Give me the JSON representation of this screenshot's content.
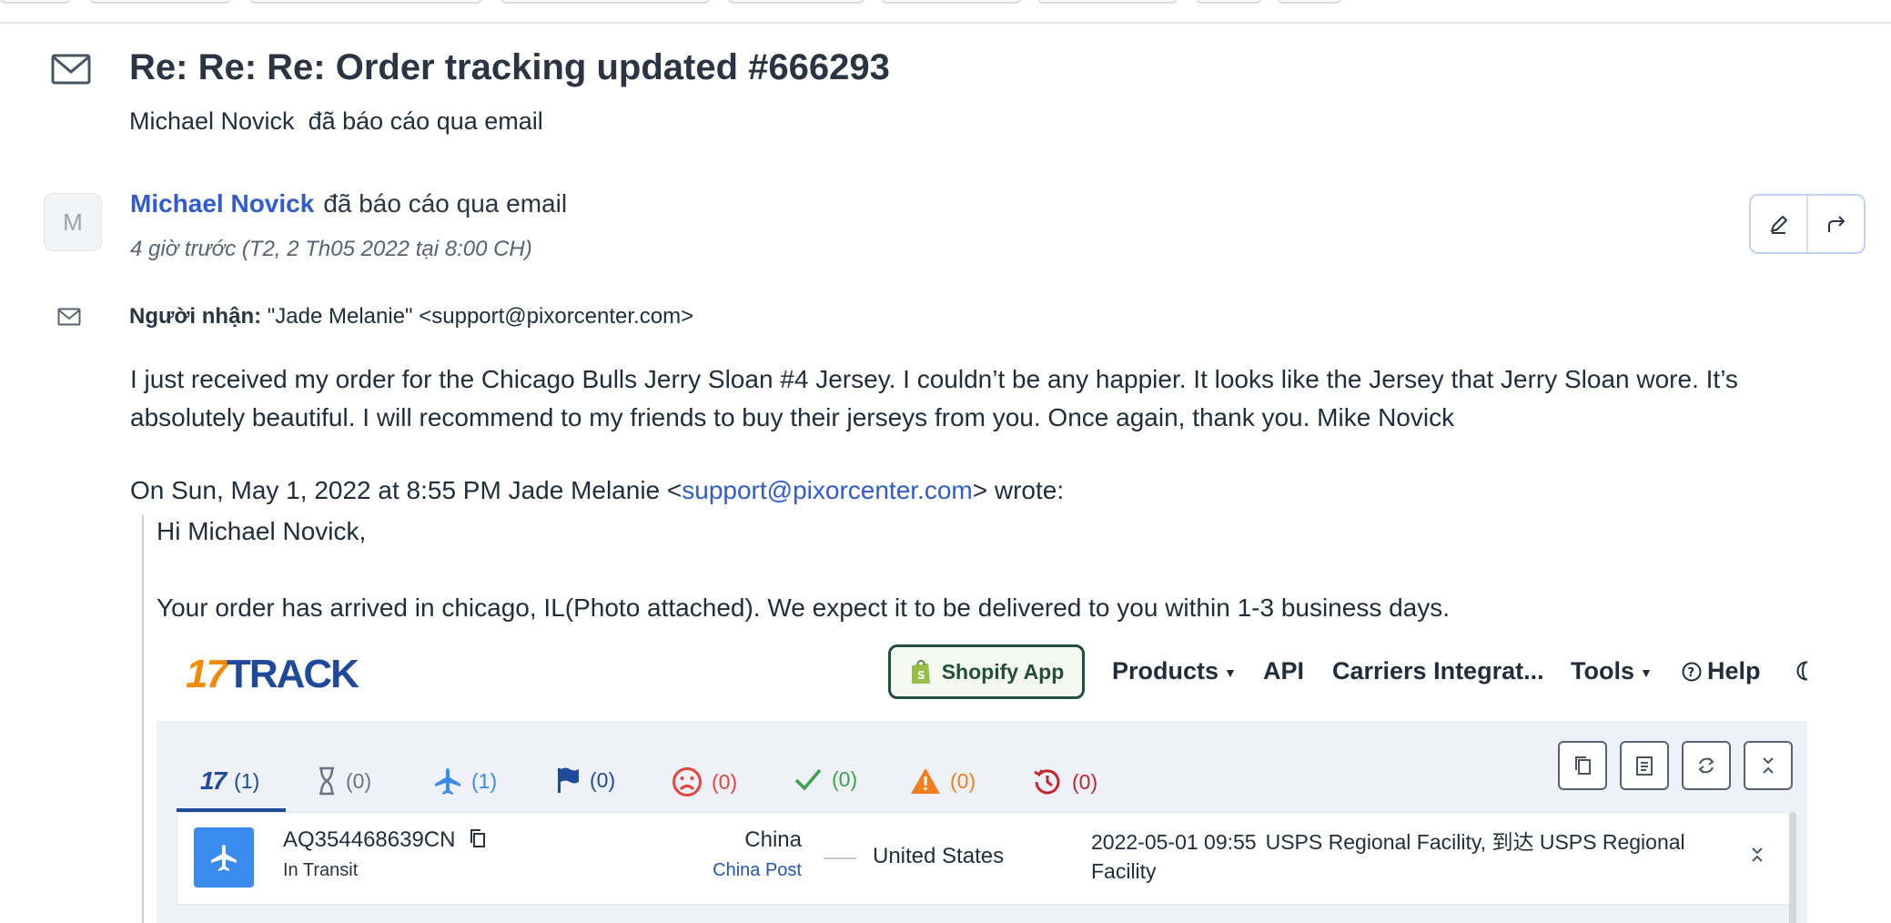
{
  "ticket": {
    "subject": "Re: Re: Re: Order tracking updated #666293",
    "reporter_name": "Michael Novick",
    "reporter_action": "đã báo cáo qua email"
  },
  "message": {
    "avatar_letter": "M",
    "author": "Michael Novick",
    "action": "đã báo cáo qua email",
    "timestamp": "4 giờ trước (T2, 2 Th05 2022 tại 8:00 CH)",
    "recipient_label": "Người nhận:",
    "recipient_value": "\"Jade Melanie\" <support@pixorcenter.com>",
    "body": "I just received my order for the Chicago Bulls Jerry Sloan #4 Jersey. I couldn’t be any happier. It looks like the Jersey that Jerry Sloan wore. It’s absolutely beautiful. I will recommend to my friends to buy their jerseys from you. Once again, thank you. Mike Novick",
    "quote_prefix": "On Sun, May 1, 2022 at 8:55 PM Jade Melanie <",
    "quote_email": "support@pixorcenter.com",
    "quote_suffix": "> wrote:",
    "greeting": "Hi Michael Novick,",
    "arrived": "Your order has arrived in chicago, IL(Photo attached). We expect it to be delivered to you within 1-3 business days."
  },
  "track": {
    "logo_num": "17",
    "logo_word": "TRACK",
    "shopify_label": "Shopify App",
    "nav": [
      "Products",
      "API",
      "Carriers Integrat...",
      "Tools",
      "Help"
    ],
    "tabs": [
      {
        "label": "(1)",
        "icon": "17-logo-icon",
        "color": "#1f4a9c"
      },
      {
        "label": "(0)",
        "icon": "hourglass-icon",
        "color": "#6b7280"
      },
      {
        "label": "(1)",
        "icon": "airplane-icon",
        "color": "#3a8bed"
      },
      {
        "label": "(0)",
        "icon": "flag-icon",
        "color": "#1f4a9c"
      },
      {
        "label": "(0)",
        "icon": "sad-face-icon",
        "color": "#e0463a"
      },
      {
        "label": "(0)",
        "icon": "check-icon",
        "color": "#3fa34d"
      },
      {
        "label": "(0)",
        "icon": "warning-icon",
        "color": "#f07d1e"
      },
      {
        "label": "(0)",
        "icon": "history-icon",
        "color": "#c0272d"
      }
    ],
    "row": {
      "number": "AQ354468639CN",
      "status": "In Transit",
      "origin": "China",
      "carrier": "China Post",
      "destination": "United States",
      "event_time": "2022-05-01 09:55",
      "event_text": "USPS Regional Facility, 到达 USPS Regional Facility"
    }
  }
}
